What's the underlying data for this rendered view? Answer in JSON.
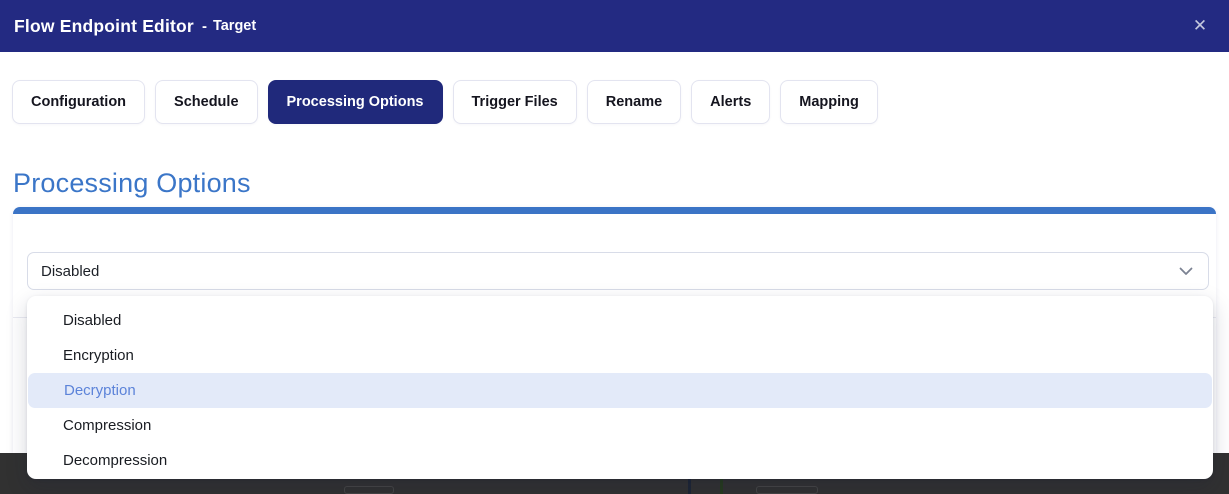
{
  "header": {
    "title": "Flow Endpoint Editor",
    "separator": "-",
    "subtitle": "Target",
    "close_glyph": "✕"
  },
  "tabs": [
    {
      "label": "Configuration",
      "active": false
    },
    {
      "label": "Schedule",
      "active": false
    },
    {
      "label": "Processing Options",
      "active": true
    },
    {
      "label": "Trigger Files",
      "active": false
    },
    {
      "label": "Rename",
      "active": false
    },
    {
      "label": "Alerts",
      "active": false
    },
    {
      "label": "Mapping",
      "active": false
    }
  ],
  "section": {
    "heading": "Processing Options"
  },
  "processing_select": {
    "value": "Disabled",
    "chevron_icon": "chevron-down"
  },
  "dropdown": {
    "options": [
      {
        "label": "Disabled",
        "highlighted": false
      },
      {
        "label": "Encryption",
        "highlighted": false
      },
      {
        "label": "Decryption",
        "highlighted": true
      },
      {
        "label": "Compression",
        "highlighted": false
      },
      {
        "label": "Decompression",
        "highlighted": false
      }
    ]
  },
  "colors": {
    "titlebar_navy": "#232a82",
    "active_tab_navy": "#20297b",
    "heading_blue": "#3b76c8",
    "card_topbar_blue": "#3b74c6",
    "highlight_bg": "#e3eaf9",
    "highlight_text": "#5c83d9",
    "backdrop_dark": "#313131"
  }
}
